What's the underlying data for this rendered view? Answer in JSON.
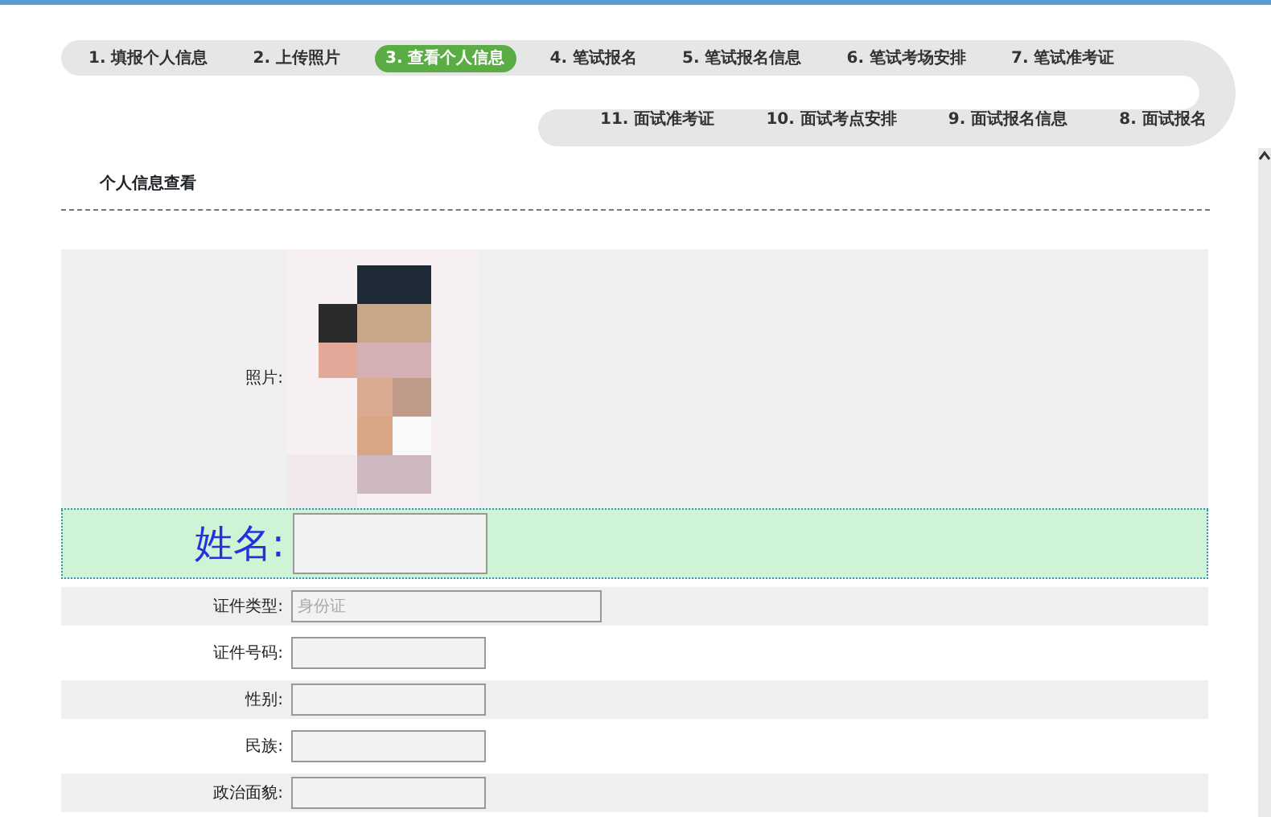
{
  "steps": [
    [
      {
        "label": "1. 填报个人信息",
        "selected": false
      },
      {
        "label": "2. 上传照片",
        "selected": false
      },
      {
        "label": "3. 查看个人信息",
        "selected": true
      },
      {
        "label": "4. 笔试报名",
        "selected": false
      },
      {
        "label": "5. 笔试报名信息",
        "selected": false
      },
      {
        "label": "6. 笔试考场安排",
        "selected": false
      },
      {
        "label": "7. 笔试准考证",
        "selected": false
      }
    ],
    [
      {
        "label": "11. 面试准考证",
        "selected": false
      },
      {
        "label": "10. 面试考点安排",
        "selected": false
      },
      {
        "label": "9. 面试报名信息",
        "selected": false
      },
      {
        "label": "8. 面试报名",
        "selected": false
      }
    ]
  ],
  "section_title": "个人信息查看",
  "form": [
    {
      "label": "照片:"
    },
    {
      "kind": "name",
      "label": "姓名:",
      "disabled": true
    },
    {
      "kind": "wide",
      "label": "证件类型:",
      "value": "身份证",
      "disabled": true
    },
    {
      "kind": "text",
      "label": "证件号码:",
      "disabled": true
    },
    {
      "kind": "text",
      "label": "性别:",
      "disabled": true
    },
    {
      "kind": "text",
      "label": "民族:",
      "disabled": true
    },
    {
      "kind": "text",
      "label": "政治面貌:",
      "disabled": true
    }
  ]
}
